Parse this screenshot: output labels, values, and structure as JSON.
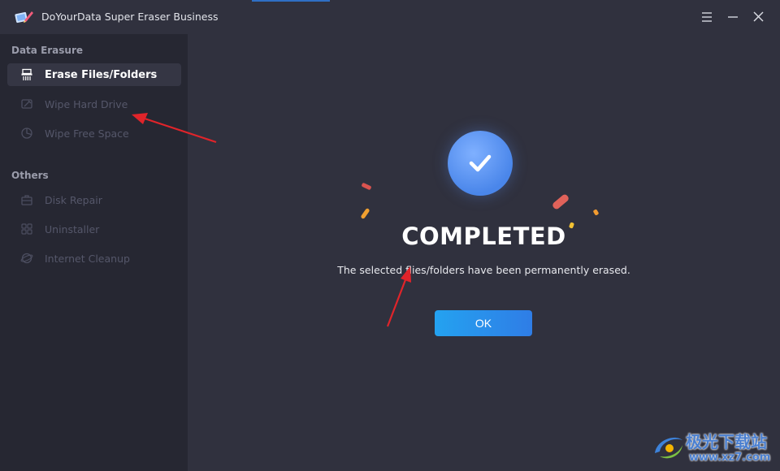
{
  "window": {
    "title": "DoYourData Super Eraser Business"
  },
  "sidebar": {
    "sections": [
      {
        "title": "Data Erasure",
        "items": [
          {
            "label": "Erase Files/Folders",
            "icon": "shredder-icon",
            "active": true
          },
          {
            "label": "Wipe Hard Drive",
            "icon": "hard-drive-icon",
            "active": false
          },
          {
            "label": "Wipe Free Space",
            "icon": "pie-icon",
            "active": false
          }
        ]
      },
      {
        "title": "Others",
        "items": [
          {
            "label": "Disk Repair",
            "icon": "toolbox-icon",
            "active": false
          },
          {
            "label": "Uninstaller",
            "icon": "grid-icon",
            "active": false
          },
          {
            "label": "Internet Cleanup",
            "icon": "browser-icon",
            "active": false
          }
        ]
      }
    ]
  },
  "main": {
    "status_title": "COMPLETED",
    "message": "The selected flies/folders have been permanently erased.",
    "ok_label": "OK"
  },
  "watermark": {
    "line1": "极光下载站",
    "line2": "www.xz7.com"
  },
  "colors": {
    "accent": "#2f8ff0",
    "check_circle": "#5b95f0",
    "arrow": "#e0242a"
  }
}
